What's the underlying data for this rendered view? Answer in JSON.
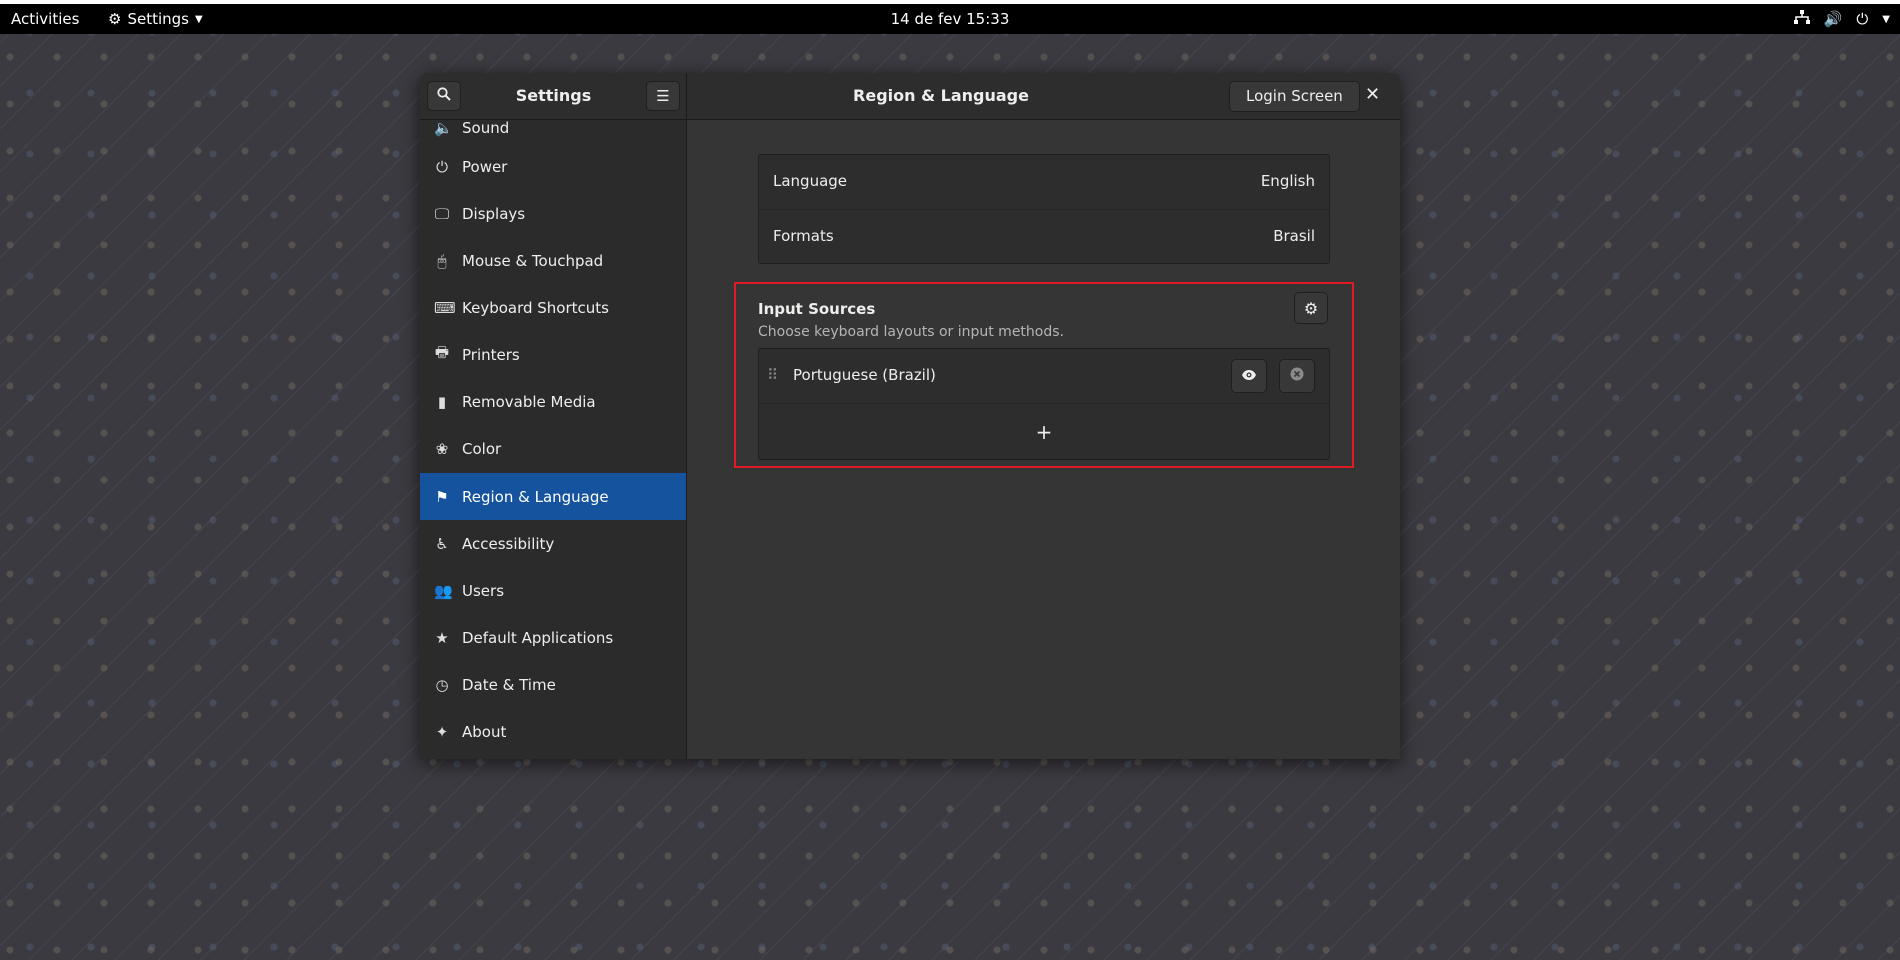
{
  "topbar": {
    "activities": "Activities",
    "app_name": "Settings",
    "clock": "14 de fev  15:33"
  },
  "header": {
    "sidebar_title": "Settings",
    "page_title": "Region & Language",
    "login_screen_label": "Login Screen"
  },
  "sidebar": {
    "items": [
      {
        "label": "Sound",
        "icon": "speaker-icon"
      },
      {
        "label": "Power",
        "icon": "power-icon"
      },
      {
        "label": "Displays",
        "icon": "display-icon"
      },
      {
        "label": "Mouse & Touchpad",
        "icon": "mouse-icon"
      },
      {
        "label": "Keyboard Shortcuts",
        "icon": "keyboard-icon"
      },
      {
        "label": "Printers",
        "icon": "printer-icon"
      },
      {
        "label": "Removable Media",
        "icon": "usb-icon"
      },
      {
        "label": "Color",
        "icon": "color-icon"
      },
      {
        "label": "Region & Language",
        "icon": "flag-icon"
      },
      {
        "label": "Accessibility",
        "icon": "accessibility-icon"
      },
      {
        "label": "Users",
        "icon": "users-icon"
      },
      {
        "label": "Default Applications",
        "icon": "star-icon"
      },
      {
        "label": "Date & Time",
        "icon": "clock-icon"
      },
      {
        "label": "About",
        "icon": "sparkle-icon"
      }
    ],
    "active_index": 8
  },
  "main": {
    "language_label": "Language",
    "language_value": "English",
    "formats_label": "Formats",
    "formats_value": "Brasil",
    "input_sources_title": "Input Sources",
    "input_sources_subtitle": "Choose keyboard layouts or input methods.",
    "sources": [
      {
        "name": "Portuguese (Brazil)"
      }
    ],
    "add_label": "+"
  },
  "colors": {
    "accent": "#15539e",
    "highlight_border": "#e01b24"
  }
}
